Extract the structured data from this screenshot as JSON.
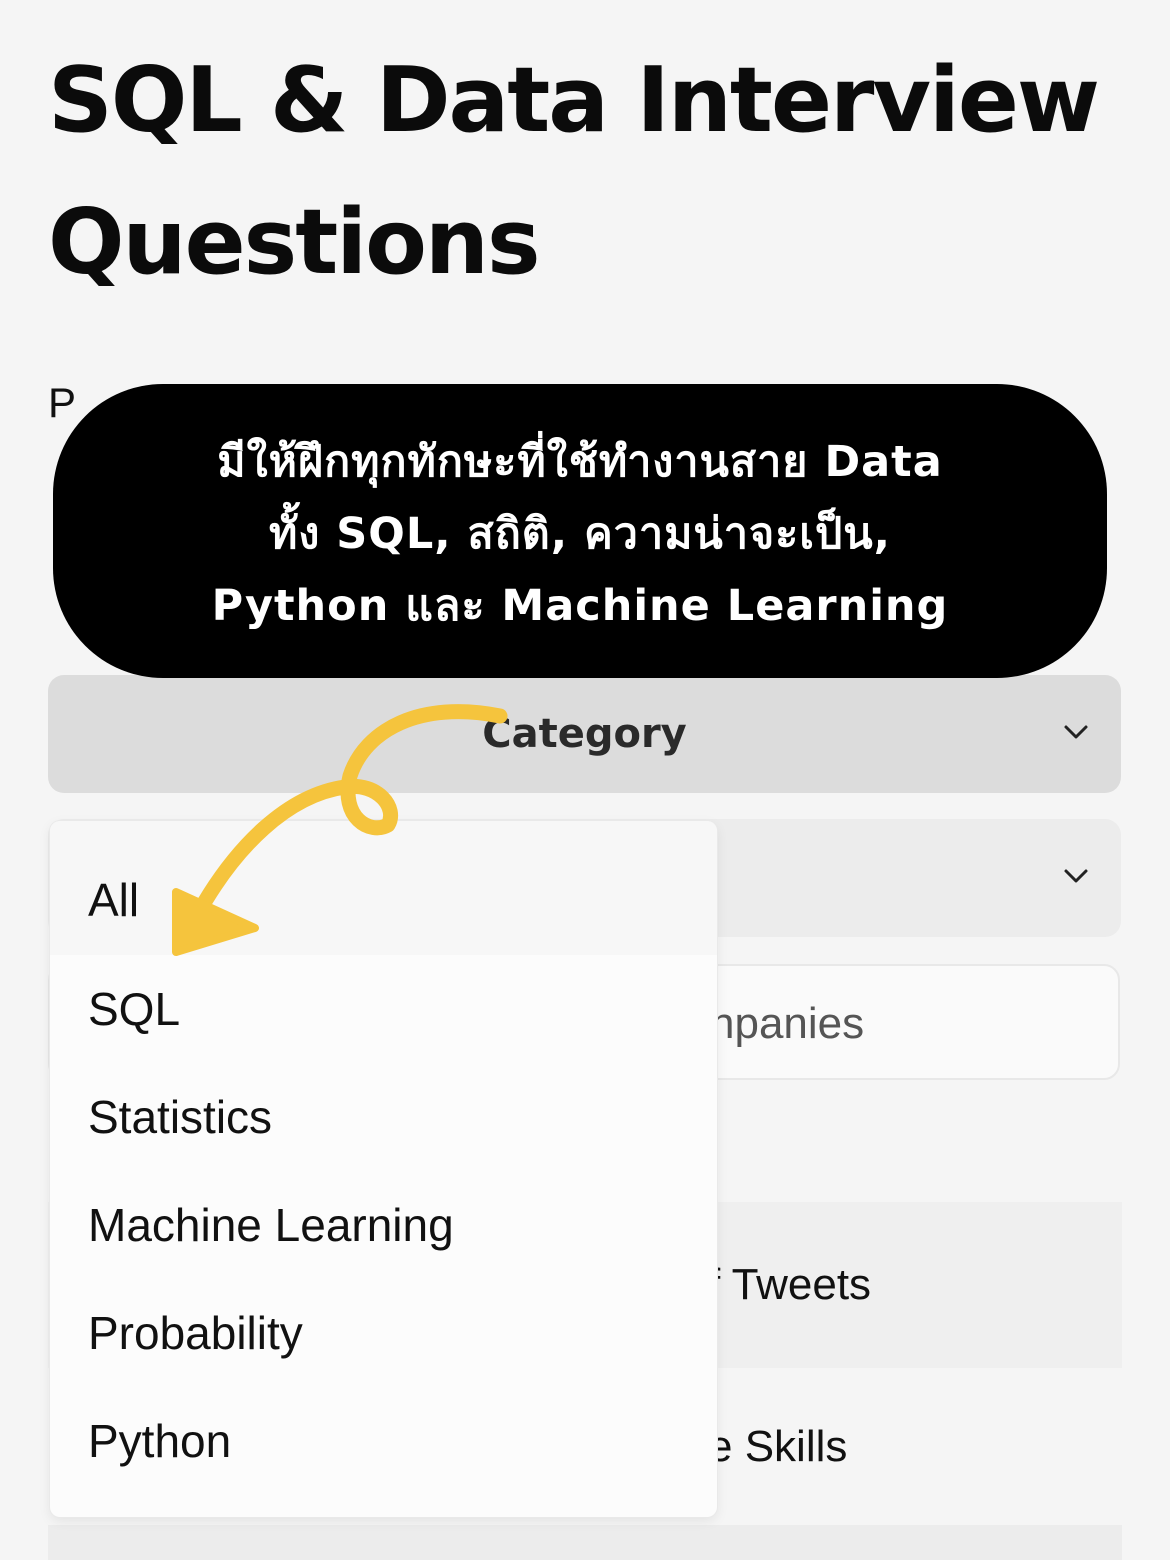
{
  "page_title": "SQL & Data Interview Questions",
  "intro_text_partial": "P",
  "annotation": {
    "lines": [
      "มีให้ฝึกทุกทักษะที่ใช้ทำงานสาย Data",
      "ทั้ง SQL, สถิติ, ความน่าจะเป็น,",
      "Python และ Machine Learning"
    ],
    "background": "#000000",
    "text_color": "#ffffff"
  },
  "filters": {
    "category_label": "Category",
    "category_icon": "chevron-down-icon",
    "second_select_icon": "chevron-down-icon",
    "company_search_partial": "npanies"
  },
  "category_dropdown": {
    "selected": "All",
    "options": [
      "All",
      "SQL",
      "Statistics",
      "Machine Learning",
      "Probability",
      "Python"
    ]
  },
  "questions": [
    {
      "title_partial": "f Tweets"
    },
    {
      "title_partial": "e Skills"
    }
  ],
  "colors": {
    "page_background": "#f5f5f5",
    "category_background": "#dcdcdc",
    "arrow": "#f5c43d"
  }
}
